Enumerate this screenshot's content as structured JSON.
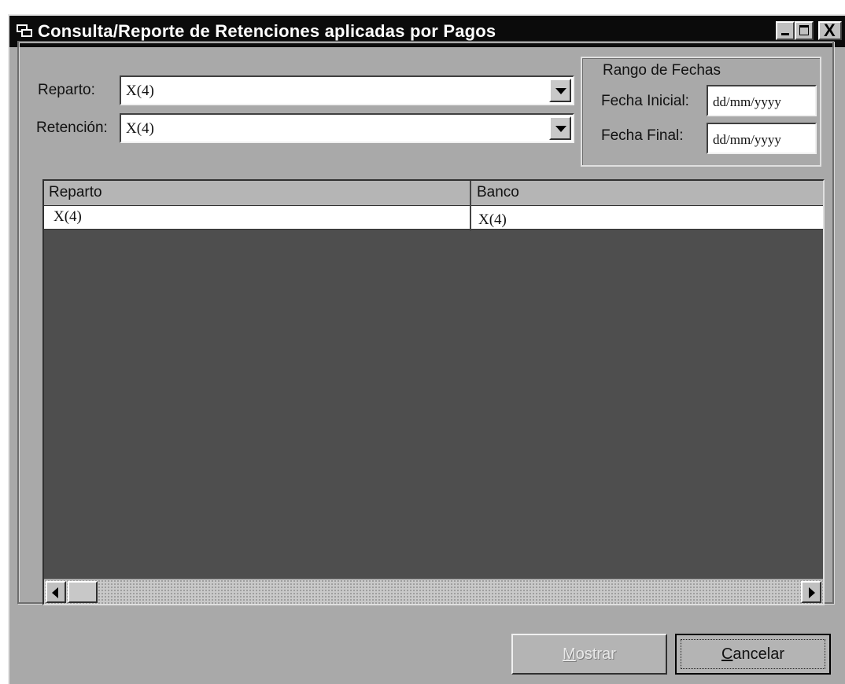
{
  "window": {
    "title": "Consulta/Reporte de Retenciones aplicadas por Pagos",
    "close_glyph": "X"
  },
  "filters": {
    "reparto_label": "Reparto:",
    "reparto_value": "X(4)",
    "retencion_label": "Retención:",
    "retencion_value": "X(4)"
  },
  "date_range": {
    "title": "Rango de Fechas",
    "start_label": "Fecha Inicial:",
    "start_value": "dd/mm/yyyy",
    "end_label": "Fecha Final:",
    "end_value": "dd/mm/yyyy"
  },
  "grid": {
    "columns": [
      "Reparto",
      "Banco"
    ],
    "rows": [
      [
        "X(4)",
        "X(4)"
      ]
    ]
  },
  "buttons": {
    "mostrar_mnemonic": "M",
    "mostrar_rest": "ostrar",
    "cancelar_mnemonic": "C",
    "cancelar_rest": "ancelar"
  },
  "colors": {
    "title_bar": "#0b0b0b",
    "window_bg": "#a9a9a9",
    "grid_bg": "#4e4e4e"
  },
  "icons": [
    "app-window-icon",
    "minimize-icon",
    "maximize-icon",
    "close-icon",
    "dropdown-arrow-icon",
    "scroll-left-icon",
    "scroll-right-icon"
  ]
}
